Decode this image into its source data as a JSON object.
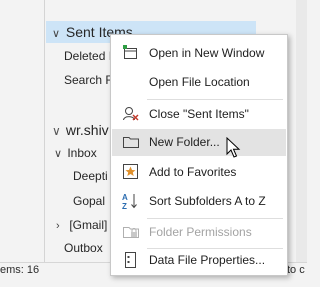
{
  "folders": {
    "sent_items": "Sent Items",
    "deleted_items": "Deleted I",
    "search_folders": "Search F",
    "account": "wr.shiv",
    "inbox": "Inbox",
    "sub1": "Deepti",
    "sub2": "Gopal",
    "gmail": "[Gmail]",
    "outbox": "Outbox"
  },
  "status": {
    "items_text": "ems: 16",
    "right_cut": "to c"
  },
  "context_menu": {
    "items": [
      {
        "label": "Open in New Window",
        "icon": "new-window-icon"
      },
      {
        "label": "Open File Location",
        "icon": "none"
      },
      {
        "label": "Close \"Sent Items\"",
        "icon": "close-folder-icon"
      },
      {
        "label": "New Folder...",
        "icon": "folder-icon"
      },
      {
        "label": "Add to Favorites",
        "icon": "favorite-star-icon"
      },
      {
        "label": "Sort Subfolders A to Z",
        "icon": "sort-az-icon"
      },
      {
        "label": "Folder Permissions",
        "icon": "permissions-icon",
        "disabled": true
      },
      {
        "label": "Data File Properties...",
        "icon": "properties-icon"
      }
    ],
    "hovered_item": "New Folder..."
  },
  "colors": {
    "selection": "#cde4f7",
    "menu_hover": "#e3e3e3",
    "accent_orange": "#d9822b",
    "accent_blue": "#2b6cb0"
  }
}
